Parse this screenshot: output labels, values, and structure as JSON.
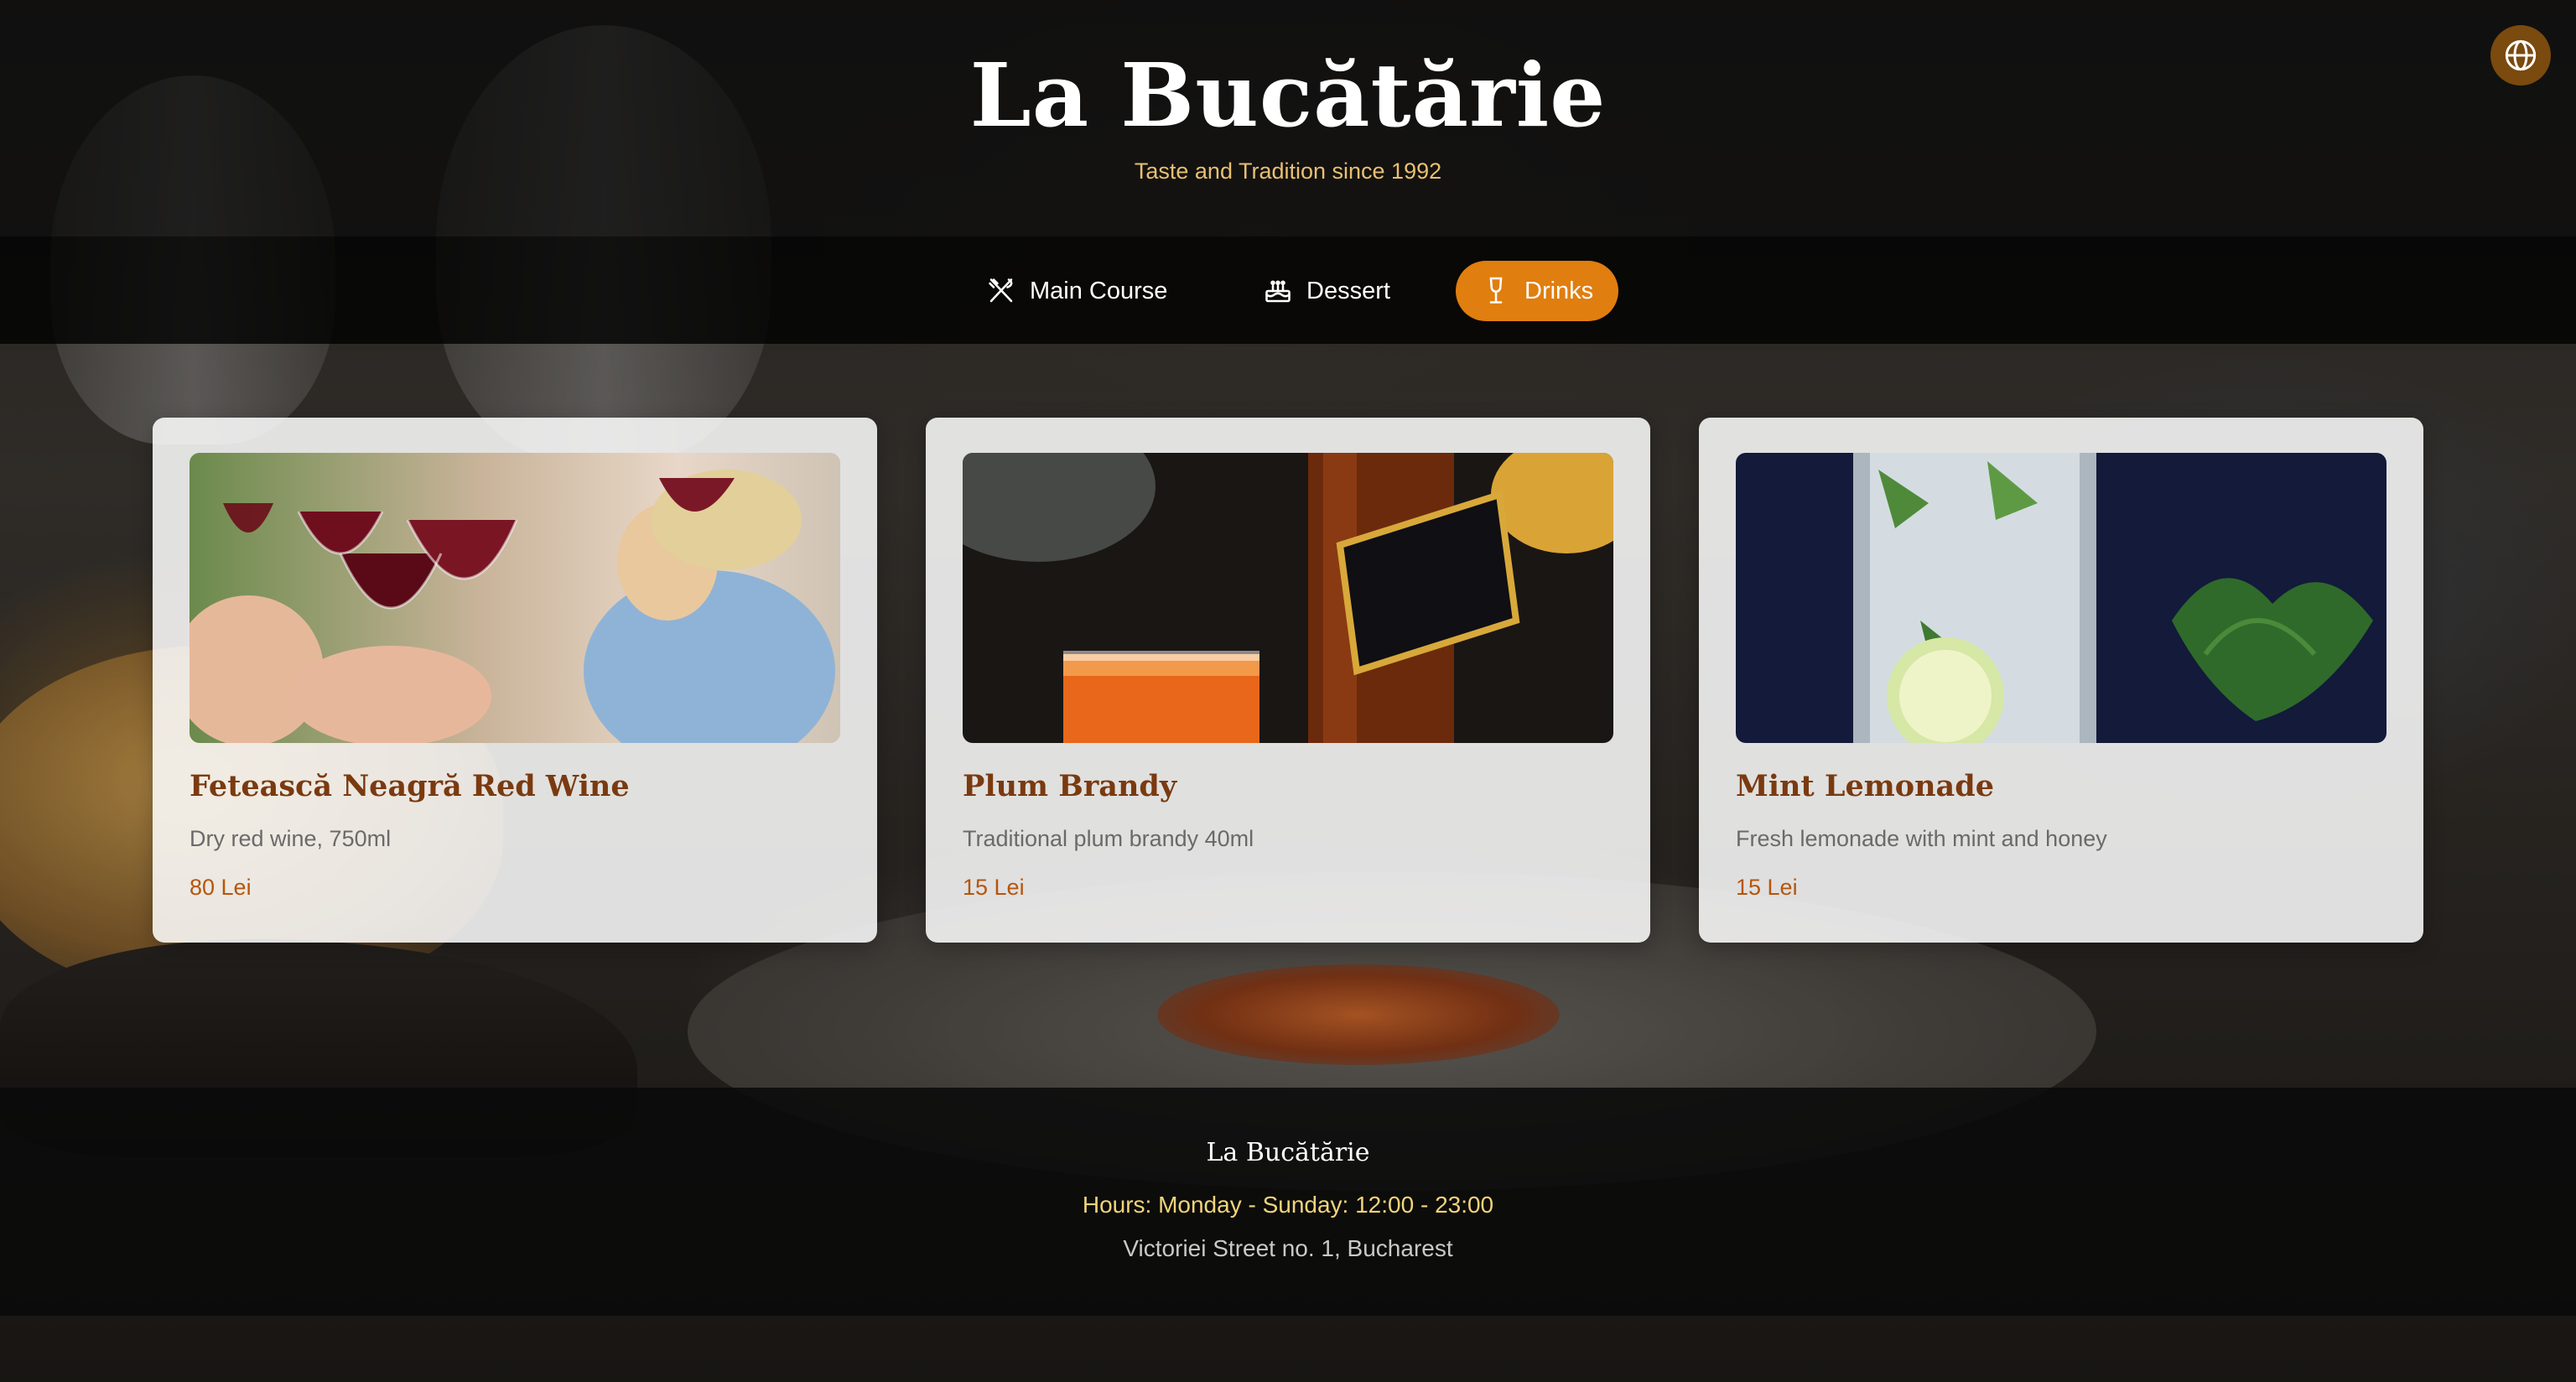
{
  "header": {
    "title": "La Bucătărie",
    "tagline": "Taste and Tradition since 1992",
    "language_button_icon": "globe-icon"
  },
  "nav": {
    "items": [
      {
        "label": "Main Course",
        "icon": "utensils-crossed-icon",
        "active": false
      },
      {
        "label": "Dessert",
        "icon": "cake-icon",
        "active": false
      },
      {
        "label": "Drinks",
        "icon": "wine-glass-icon",
        "active": true
      }
    ]
  },
  "menu": {
    "items": [
      {
        "name": "Fetească Neagră Red Wine",
        "description": "Dry red wine, 750ml",
        "price": "80 Lei",
        "image": "red-wine-glasses-photo"
      },
      {
        "name": "Plum Brandy",
        "description": "Traditional plum brandy 40ml",
        "price": "15 Lei",
        "image": "whisky-bottle-and-glass-photo"
      },
      {
        "name": "Mint Lemonade",
        "description": "Fresh lemonade with mint and honey",
        "price": "15 Lei",
        "image": "mint-lemonade-photo"
      }
    ]
  },
  "footer": {
    "name": "La Bucătărie",
    "hours": "Hours: Monday - Sunday: 12:00 - 23:00",
    "address": "Victoriei Street no. 1, Bucharest"
  },
  "colors": {
    "accent": "#e07e0f",
    "heading": "#7a3a10",
    "price": "#b5560c",
    "tagline": "#e8c070",
    "hours": "#f2d47a"
  }
}
